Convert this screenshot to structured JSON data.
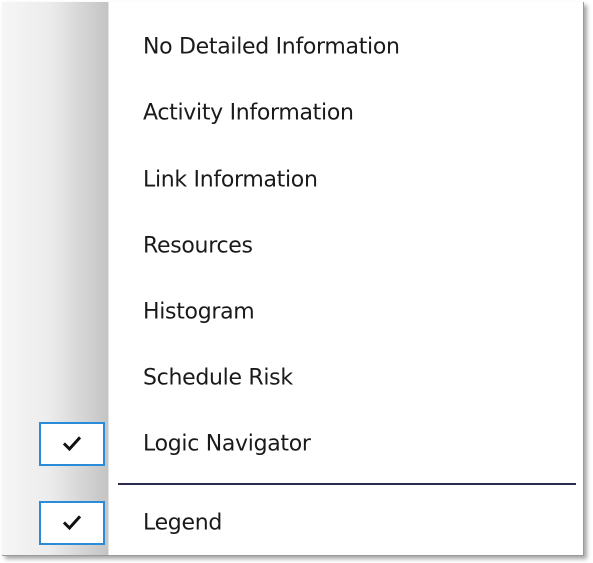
{
  "menu": {
    "items": [
      {
        "label": "No Detailed Information",
        "checked": false
      },
      {
        "label": "Activity Information",
        "checked": false
      },
      {
        "label": "Link Information",
        "checked": false
      },
      {
        "label": "Resources",
        "checked": false
      },
      {
        "label": "Histogram",
        "checked": false
      },
      {
        "label": "Schedule Risk",
        "checked": false
      },
      {
        "label": "Logic Navigator",
        "checked": true
      },
      {
        "label": "Legend",
        "checked": true
      }
    ],
    "check_icon": "checkmark-icon",
    "check_border_color": "#2a8bd8",
    "separator_color": "#2b2b4e"
  }
}
